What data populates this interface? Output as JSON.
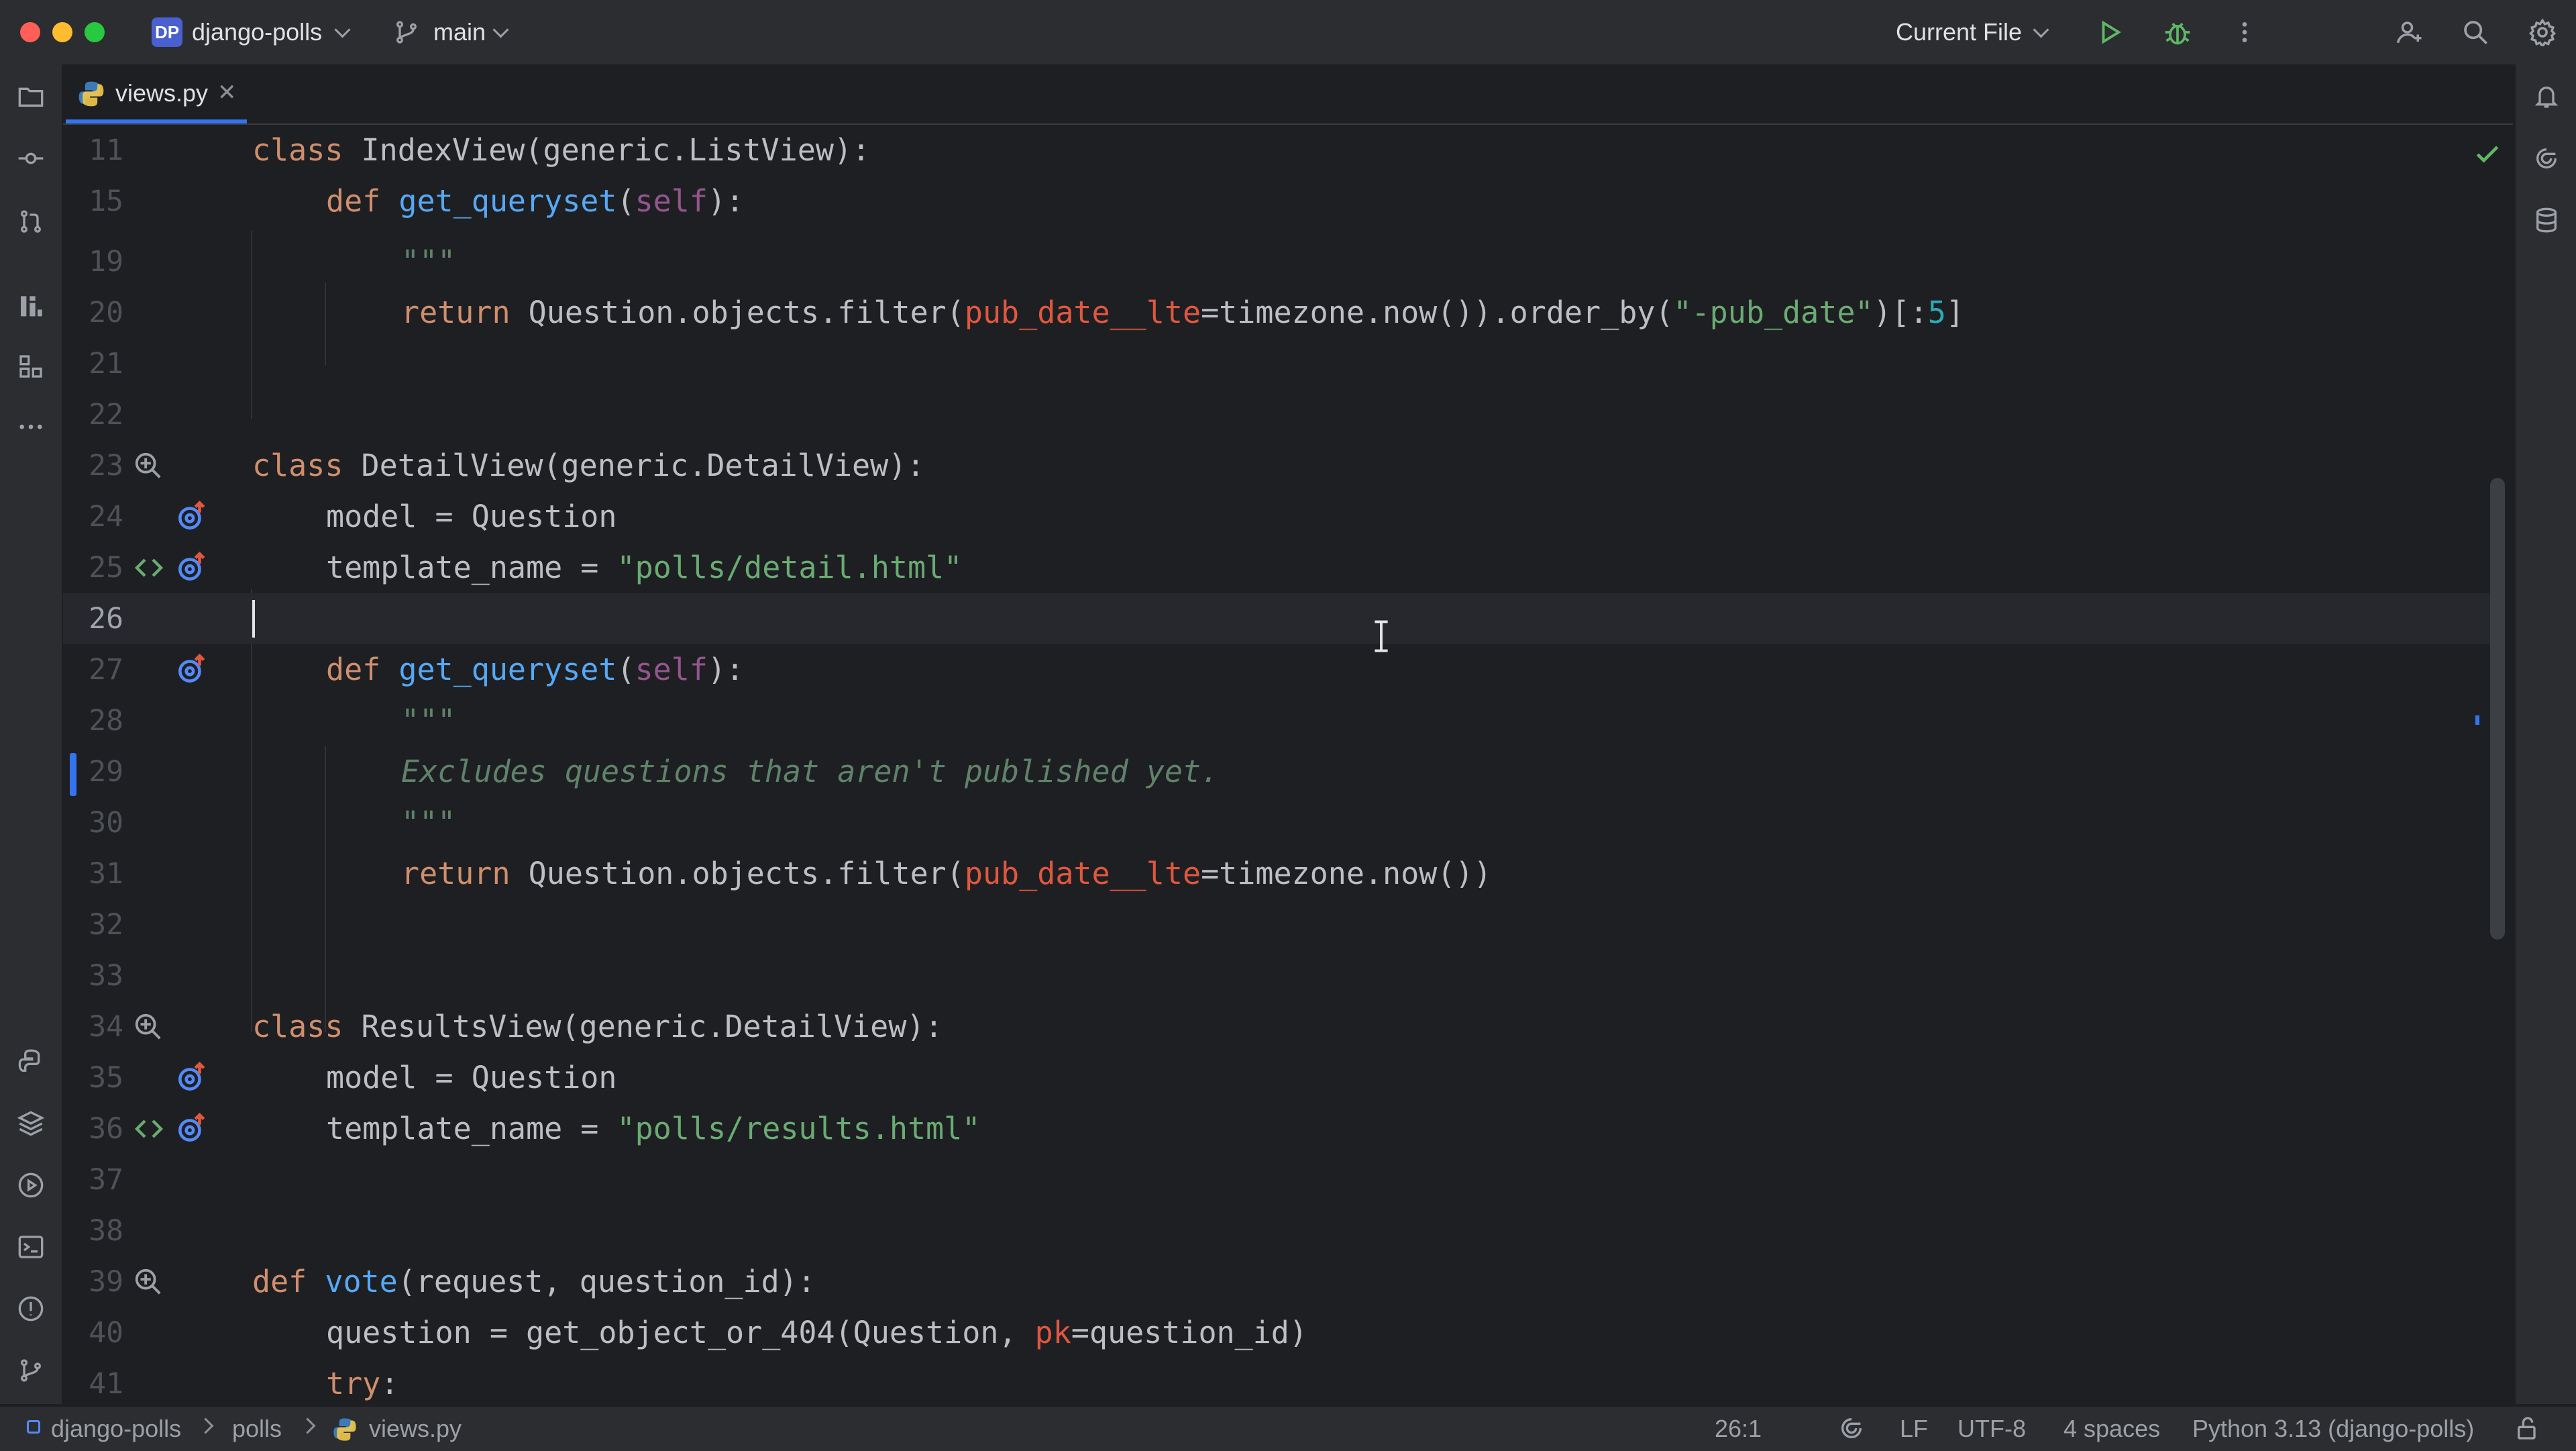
{
  "titlebar": {
    "project_badge": "DP",
    "project_name": "django-polls",
    "branch": "main",
    "run_config": "Current File"
  },
  "tab": {
    "file_name": "views.py"
  },
  "editor": {
    "lines": [
      {
        "num": "11"
      },
      {
        "num": "15"
      },
      {
        "num": "19"
      },
      {
        "num": "20"
      },
      {
        "num": "21"
      },
      {
        "num": "22"
      },
      {
        "num": "23"
      },
      {
        "num": "24"
      },
      {
        "num": "25"
      },
      {
        "num": "26"
      },
      {
        "num": "27"
      },
      {
        "num": "28"
      },
      {
        "num": "29"
      },
      {
        "num": "30"
      },
      {
        "num": "31"
      },
      {
        "num": "32"
      },
      {
        "num": "33"
      },
      {
        "num": "34"
      },
      {
        "num": "35"
      },
      {
        "num": "36"
      },
      {
        "num": "37"
      },
      {
        "num": "38"
      },
      {
        "num": "39"
      },
      {
        "num": "40"
      },
      {
        "num": "41"
      }
    ],
    "tokens": {
      "l11": {
        "kw": "class",
        "rest": " IndexView(generic.ListView):"
      },
      "l15": {
        "kw": "def",
        "fn": "get_queryset",
        "p1": "(",
        "self": "self",
        "p2": "):"
      },
      "l19": {
        "doc": "\"\"\""
      },
      "l20": {
        "kw": "return",
        "a": " Question.objects.filter(",
        "param": "pub_date__lte",
        "b": "=timezone.now()).order_by(",
        "str": "\"-pub_date\"",
        "c": ")[:",
        "num": "5",
        "d": "]"
      },
      "l23": {
        "kw": "class",
        "rest": " DetailView(generic.DetailView):"
      },
      "l24": {
        "rest": "model = Question"
      },
      "l25": {
        "rest": "template_name = ",
        "str": "\"polls/detail.html\""
      },
      "l27": {
        "kw": "def",
        "fn": "get_queryset",
        "p1": "(",
        "self": "self",
        "p2": "):"
      },
      "l28": {
        "doc": "\"\"\""
      },
      "l29": {
        "doc": "Excludes questions that aren't published yet."
      },
      "l30": {
        "doc": "\"\"\""
      },
      "l31": {
        "kw": "return",
        "a": " Question.objects.filter(",
        "param": "pub_date__lte",
        "b": "=timezone.now())"
      },
      "l34": {
        "kw": "class",
        "rest": " ResultsView(generic.DetailView):"
      },
      "l35": {
        "rest": "model = Question"
      },
      "l36": {
        "rest": "template_name = ",
        "str": "\"polls/results.html\""
      },
      "l39": {
        "kw": "def",
        "fn": "vote",
        "rest": "(request, question_id):"
      },
      "l40": {
        "a": "question = get_object_or_404(Question, ",
        "param": "pk",
        "b": "=question_id)"
      },
      "l41": {
        "kw": "try",
        "rest": ":"
      }
    },
    "current_line": "26"
  },
  "statusbar": {
    "breadcrumb": [
      "django-polls",
      "polls",
      "views.py"
    ],
    "cursor_position": "26:1",
    "line_separator": "LF",
    "encoding": "UTF-8",
    "indent": "4 spaces",
    "interpreter": "Python 3.13 (django-polls)"
  },
  "colors": {
    "accent": "#3574f0",
    "keyword": "#cf8e6d",
    "function": "#56a8f5",
    "string": "#6aab73",
    "param": "#e0573f",
    "docstring": "#5f826b"
  }
}
